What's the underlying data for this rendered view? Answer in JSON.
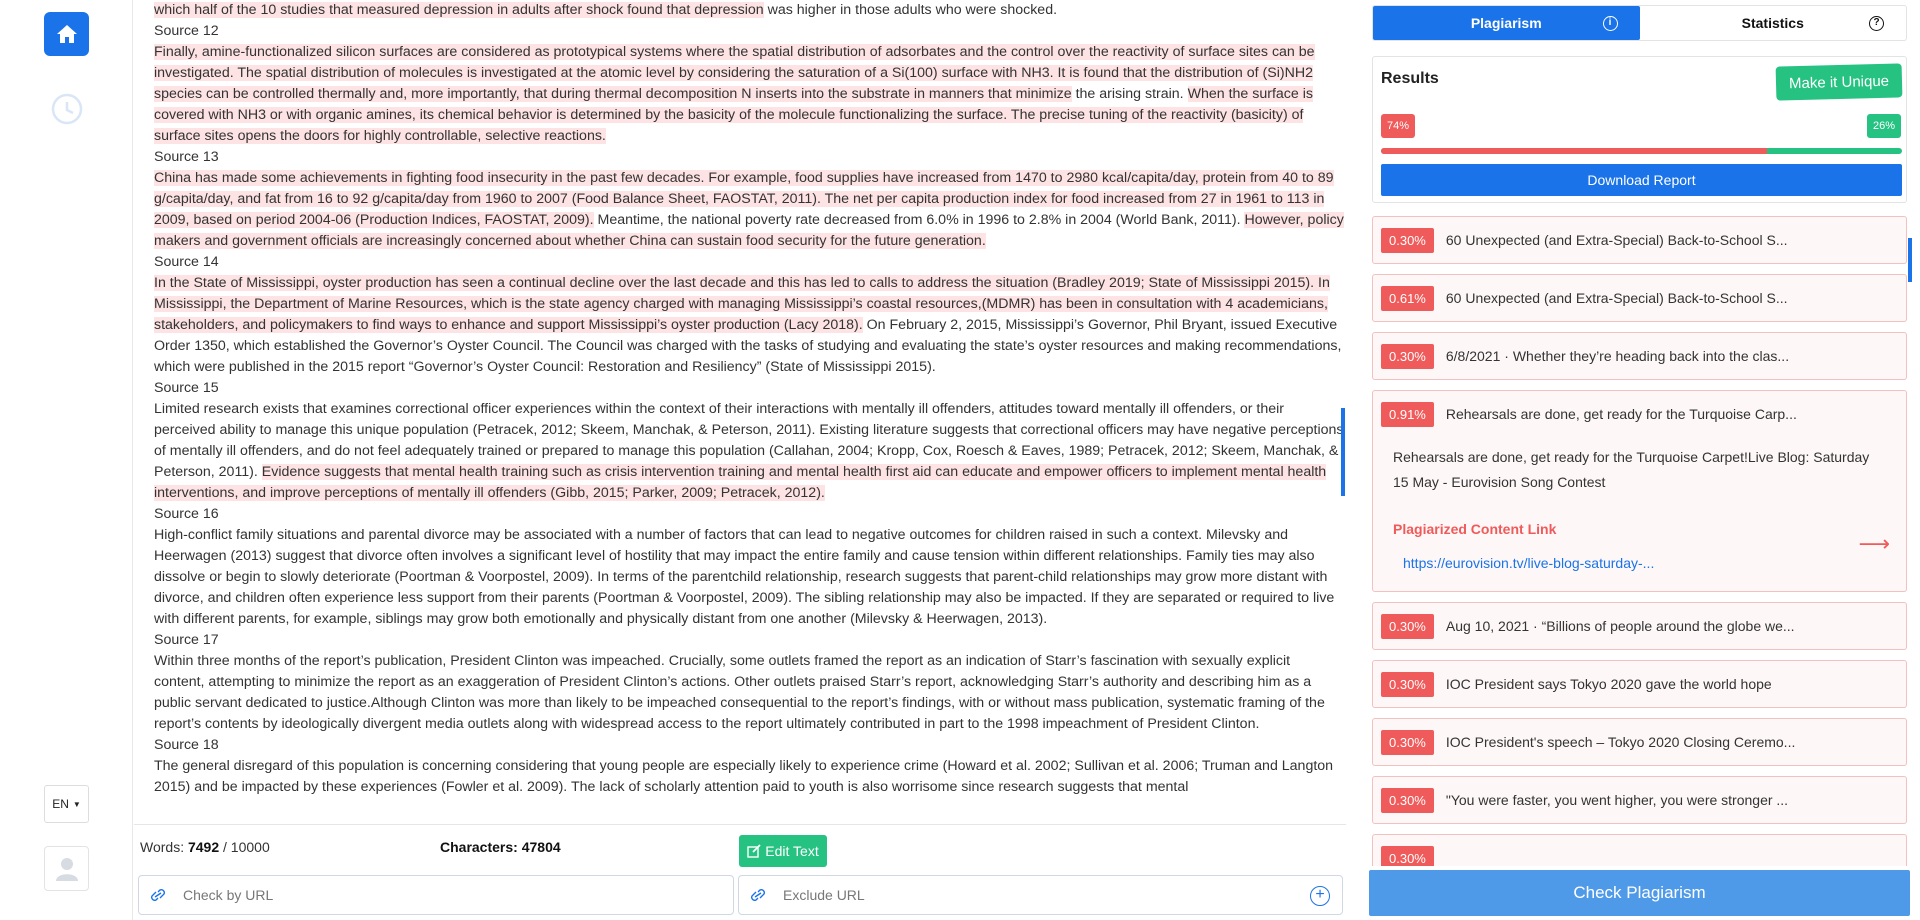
{
  "rail": {
    "language": "EN"
  },
  "text": [
    {
      "type": "text",
      "parts": [
        {
          "t": "which half of the 10 studies that measured depression in adults after shock found that depression",
          "hl": true
        },
        {
          "t": " was higher in those adults who were shocked.",
          "hl": false
        }
      ]
    },
    {
      "type": "label",
      "label": "Source 12"
    },
    {
      "type": "text",
      "parts": [
        {
          "t": "Finally, amine-functionalized silicon surfaces are considered as prototypical systems where the spatial distribution of adsorbates and the control over the reactivity of surface sites can be investigated. The spatial distribution of molecules is investigated at the atomic level by considering the saturation of a Si(100) surface with NH3. It is found that the distribution of (Si)NH2 species can be controlled thermally and, more importantly, that during thermal decomposition N inserts into the substrate in manners that minimize",
          "hl": true
        },
        {
          "t": " the arising strain. ",
          "hl": false
        },
        {
          "t": "When the surface is covered with NH3 or with organic amines, its chemical behavior is determined by the basicity of the molecule functionalizing the surface. The precise tuning of the reactivity (basicity) of surface sites opens the doors for highly controllable, selective reactions.",
          "hl": true
        }
      ]
    },
    {
      "type": "label",
      "label": "Source 13"
    },
    {
      "type": "text",
      "parts": [
        {
          "t": "China has made some achievements in fighting food insecurity in the past few decades. For example, food supplies have increased from 1470 to 2980 kcal/capita/day, protein from 40 to 89 g/capita/day, and fat from 16 to 92 g/capita/day from 1960 to 2007 (Food Balance Sheet, FAOSTAT, 2011). The net per capita production index for food increased from 27 in 1961 to 113 in 2009, based on period 2004-06 (Production Indices, FAOSTAT, 2009).",
          "hl": true
        },
        {
          "t": " Meantime, the national poverty rate decreased from 6.0% in 1996 to 2.8% in 2004 (World Bank, 2011). ",
          "hl": false
        },
        {
          "t": "However, policy makers and government officials are increasingly concerned about whether China can sustain food security for the future generation.",
          "hl": true
        }
      ]
    },
    {
      "type": "label",
      "label": "Source 14"
    },
    {
      "type": "text",
      "parts": [
        {
          "t": "In the State of Mississippi, oyster production has seen a continual decline over the last decade and this has led to calls to address the situation (Bradley 2019; State of Mississippi 2015). In Mississippi, the Department of Marine Resources, which is the state agency charged with managing Mississippi’s coastal resources,(MDMR) has been in consultation with 4 academicians, stakeholders, and policymakers to find ways to enhance and support Mississippi’s oyster production (Lacy 2018).",
          "hl": true
        },
        {
          "t": " On February 2, 2015, Mississippi’s Governor, Phil Bryant, issued Executive Order 1350, which established the Governor’s Oyster Council. The Council was charged with the tasks of studying and evaluating the state’s oyster resources and making recommendations, which were published in the 2015 report “Governor’s Oyster Council: Restoration and Resiliency” (State of Mississippi 2015).",
          "hl": false
        }
      ]
    },
    {
      "type": "label",
      "label": "Source 15"
    },
    {
      "type": "text",
      "parts": [
        {
          "t": "Limited research exists that examines correctional officer experiences within the context of their interactions with mentally ill offenders, attitudes toward mentally ill offenders, or their perceived ability to manage this unique population (Petracek, 2012; Skeem, Manchak, & Peterson, 2011). Existing literature suggests that correctional officers may have negative perceptions of mentally ill offenders, and do not feel adequately trained or prepared to manage this population (Callahan, 2004; Kropp, Cox, Roesch & Eaves, 1989; Petracek, 2012; Skeem, Manchak, & Peterson, 2011). ",
          "hl": false
        },
        {
          "t": "Evidence suggests that mental health training such as crisis intervention training and mental health first aid can educate and empower officers to implement mental health interventions, and improve perceptions of mentally ill offenders (Gibb, 2015; Parker, 2009; Petracek, 2012).",
          "hl": true
        }
      ]
    },
    {
      "type": "label",
      "label": "Source 16"
    },
    {
      "type": "text",
      "parts": [
        {
          "t": "High-conflict family situations and parental divorce may be associated with a number of factors that can lead to negative outcomes for children raised in such a context. Milevsky and Heerwagen (2013) suggest that divorce often involves a significant level of hostility that may impact the entire family and cause tension within different relationships. Family ties may also dissolve or begin to slowly deteriorate (Poortman & Voorpostel, 2009). In terms of the parentchild relationship, research suggests that parent-child relationships may grow more distant with divorce, and children often experience less support from their parents (Poortman & Voorpostel, 2009). The sibling relationship may also be impacted. If they are separated or required to live with different parents, for example, siblings may grow both emotionally and physically distant from one another (Milevsky & Heerwagen, 2013).",
          "hl": false
        }
      ]
    },
    {
      "type": "label",
      "label": "Source 17"
    },
    {
      "type": "text",
      "parts": [
        {
          "t": "Within three months of the report’s publication, President Clinton was impeached. Crucially, some outlets framed the report as an indication of Starr’s fascination with sexually explicit content, attempting to minimize the report as an exaggeration of President Clinton’s actions. Other outlets praised Starr’s report, acknowledging Starr’s authority and describing him as a public servant dedicated to justice.Although Clinton was more than likely to be impeached consequential to the report’s findings, with or without mass publication, systematic framing of the report’s contents by ideologically divergent media outlets along with widespread access to the report ultimately contributed in part to the 1998 impeachment of President Clinton.",
          "hl": false
        }
      ]
    },
    {
      "type": "label",
      "label": "Source 18"
    },
    {
      "type": "text",
      "parts": [
        {
          "t": "The general disregard of this population is concerning considering that young people are especially likely to experience crime (Howard et al. 2002; Sullivan et al. 2006; Truman and Langton 2015) and be impacted by these experiences (Fowler et al. 2009). The lack of scholarly attention paid to youth is also worrisome since research suggests that mental",
          "hl": false
        }
      ]
    }
  ],
  "footer": {
    "words_label": "Words:",
    "words_value": "7492",
    "words_limit": " / 10000",
    "chars_label": "Characters:",
    "chars_value": "47804",
    "edit_label": "Edit Text",
    "check_url_placeholder": "Check by URL",
    "exclude_url_placeholder": "Exclude URL"
  },
  "panel": {
    "tab_plagiarism": "Plagiarism",
    "tab_statistics": "Statistics",
    "results_title": "Results",
    "make_unique": "Make it Unique",
    "plag_pct_label": "74%",
    "unique_pct_label": "26%",
    "plag_fraction": 0.74,
    "download": "Download Report",
    "check_button": "Check Plagiarism"
  },
  "results": [
    {
      "pct": "0.30%",
      "title": "60 Unexpected (and Extra-Special) Back-to-School S..."
    },
    {
      "pct": "0.61%",
      "title": "60 Unexpected (and Extra-Special) Back-to-School S..."
    },
    {
      "pct": "0.30%",
      "title": "6/8/2021 · Whether they’re heading back into the clas..."
    },
    {
      "pct": "0.91%",
      "title": "Rehearsals are done, get ready for the Turquoise Carp...",
      "expanded": true,
      "desc": "Rehearsals are done, get ready for the Turquoise Carpet!Live Blog: Saturday 15 May - Eurovision Song Contest",
      "link_label": "Plagiarized Content Link",
      "link": "https://eurovision.tv/live-blog-saturday-..."
    },
    {
      "pct": "0.30%",
      "title": "Aug 10, 2021 · “Billions of people around the globe we..."
    },
    {
      "pct": "0.30%",
      "title": "IOC President says Tokyo 2020 gave the world hope"
    },
    {
      "pct": "0.30%",
      "title": "IOC President's speech – Tokyo 2020 Closing Ceremo..."
    },
    {
      "pct": "0.30%",
      "title": "\"You were faster, you went higher, you were stronger ..."
    },
    {
      "pct": "0.30%",
      "title": ""
    }
  ],
  "colors": {
    "accent": "#1a73e8",
    "green": "#26c281",
    "red": "#ef5a5a",
    "highlight": "#fde3e3"
  }
}
